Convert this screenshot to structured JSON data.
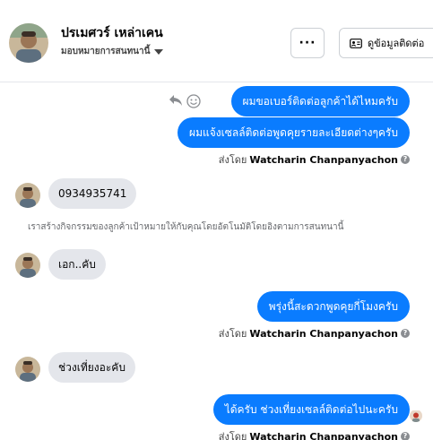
{
  "header": {
    "contact_name": "ปรเมศวร์ เหล่าเคน",
    "assignment_label": "มอบหมายการสนทนานี้",
    "more_label": "···",
    "info_button_label": "ดูข้อมูลติดต่อ"
  },
  "thread": {
    "messages": [
      {
        "direction": "outgoing",
        "text": "ผมขอเบอร์ติดต่อลูกค้าได้ไหมครับ"
      },
      {
        "direction": "outgoing",
        "text": "ผมแจ้งเซลล์ติดต่อพูดคุยรายละเอียดต่างๆครับ"
      },
      {
        "direction": "incoming",
        "text": "0934935741"
      },
      {
        "direction": "incoming",
        "text": "เอก..คับ"
      },
      {
        "direction": "outgoing",
        "text": "พรุ่งนี้สะดวกพูดคุยกี่โมงครับ"
      },
      {
        "direction": "incoming",
        "text": "ช่วงเที่ยงอะคับ"
      },
      {
        "direction": "outgoing",
        "text": "ได้ครับ ช่วงเที่ยงเซลล์ติดต่อไปนะครับ"
      }
    ],
    "sent_by_prefix": "ส่งโดย",
    "sent_by_name": "Watcharin Chanpanyachon",
    "help_mark": "?",
    "system_note": "เราสร้างกิจกรรมของลูกค้าเป้าหมายให้กับคุณโดยอัตโนมัติโดยอิงตามการสนทนานี้"
  },
  "colors": {
    "outgoing_bubble": "#0a7cff",
    "incoming_bubble": "#e4e6eb",
    "meta_text": "#65676b"
  },
  "icons": [
    "more-options-icon",
    "contact-card-icon",
    "caret-down-icon",
    "reply-icon",
    "emoji-icon",
    "help-icon"
  ]
}
